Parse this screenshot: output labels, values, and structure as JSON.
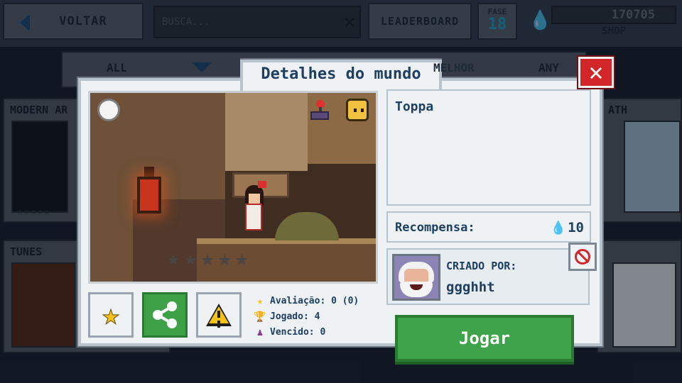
{
  "top_bar": {
    "back_label": "VOLTAR",
    "search_placeholder": "BUSCA...",
    "leaderboard_label": "LEADERBOARD",
    "fase_label": "FASE",
    "fase_value": "18",
    "coins": "170705",
    "shop_label": "SHOP"
  },
  "filters": {
    "all_label": "ALL",
    "melhor_label": "MELHOR",
    "any_label": "ANY"
  },
  "background_cards": [
    {
      "title": "MODERN AR"
    },
    {
      "title": "TUNES"
    },
    {
      "title": "ATH"
    }
  ],
  "modal": {
    "title": "Detalhes do mundo",
    "description": "Toppa",
    "reward_label": "Recompensa:",
    "reward_value": "10",
    "creator_label": "CRIADO POR:",
    "creator_name": "ggghht",
    "rating_stars": 0,
    "stats": {
      "rating": "Avaliação: 0 (0)",
      "played": "Jogado: 4",
      "won": "Vencido: 0"
    },
    "play_label": "Jogar"
  },
  "colors": {
    "title_text": "#1f3f62",
    "play_green": "#3ea34a",
    "close_red": "#d2262a",
    "panel_bg": "#eef2f5"
  }
}
